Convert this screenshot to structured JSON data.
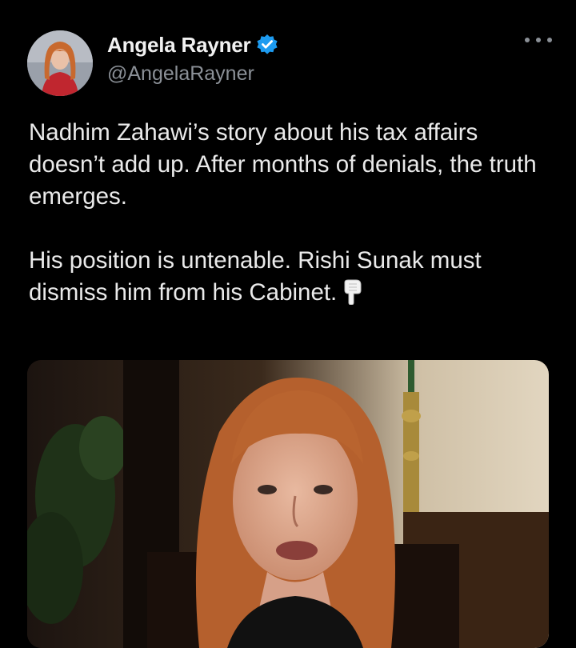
{
  "author": {
    "name": "Angela Rayner",
    "handle": "@AngelaRayner",
    "verified_icon": "verified-badge-icon",
    "verified_color": "#1d9bf0"
  },
  "tweet": {
    "paragraph1": "Nadhim Zahawi’s story about his tax affairs doesn’t add up. After months of denials, the truth emerges.",
    "paragraph2": "His position is untenable. Rishi Sunak must dismiss him from his Cabinet.",
    "emoji": "backhand-index-pointing-down"
  },
  "more_icon": "more-options-icon",
  "colors": {
    "background": "#000000",
    "text": "#e7e9ea",
    "secondary": "#8b9097"
  }
}
